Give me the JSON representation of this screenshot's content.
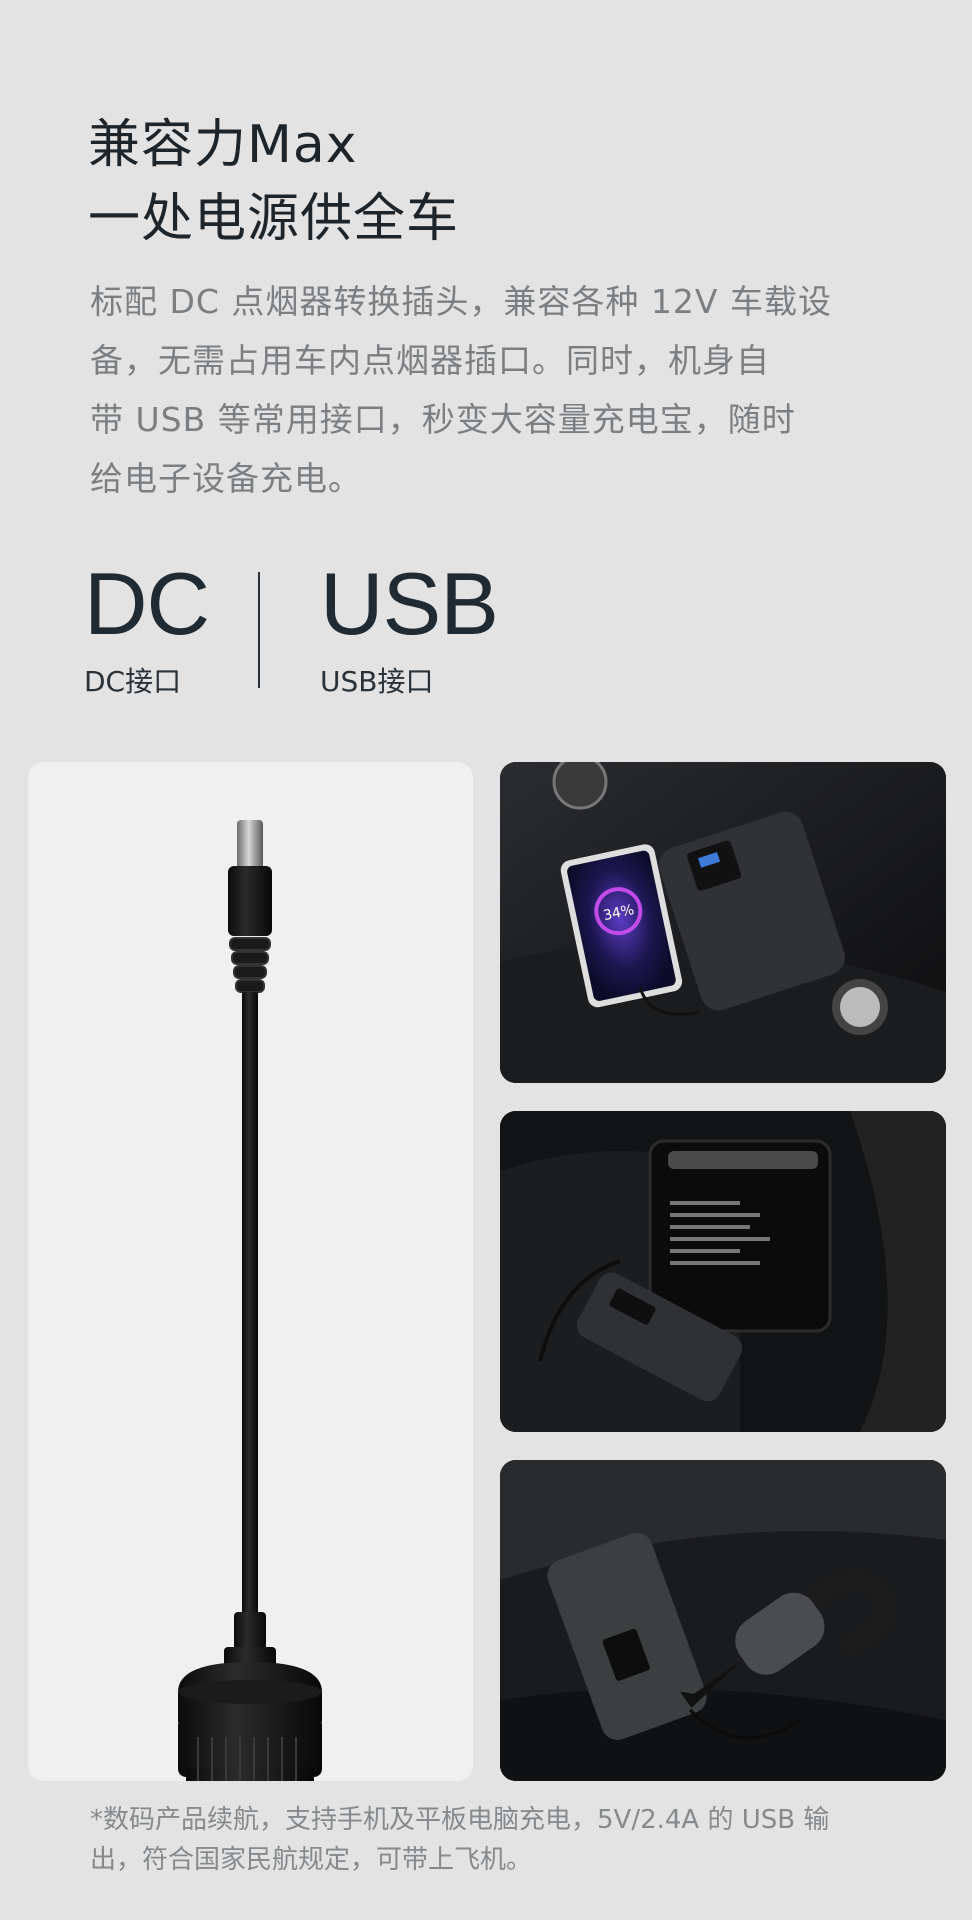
{
  "heading": {
    "line1": "兼容力Max",
    "line2": "一处电源供全车"
  },
  "description": {
    "lines": [
      "标配 DC 点烟器转换插头，兼容各种 12V 车载设",
      "备，无需占用车内点烟器插口。同时，机身自",
      "带  USB  等常用接口，秒变大容量充电宝，随时",
      "给电子设备充电。"
    ]
  },
  "ports": {
    "dc": {
      "big": "DC",
      "label": "DC接口"
    },
    "usb": {
      "big": "USB",
      "label": "USB接口"
    }
  },
  "images": {
    "adapter": "dc-cigarette-adapter",
    "phone_screen": "34%",
    "p1": "power-bank-charging-phone-in-car",
    "p2": "power-bank-with-car-fridge",
    "p3": "power-bank-with-handheld-vacuum"
  },
  "footnote": {
    "lines": [
      "*数码产品续航，支持手机及平板电脑充电，5V/2.4A 的 USB 输",
      "出，符合国家民航规定，可带上飞机。"
    ]
  }
}
